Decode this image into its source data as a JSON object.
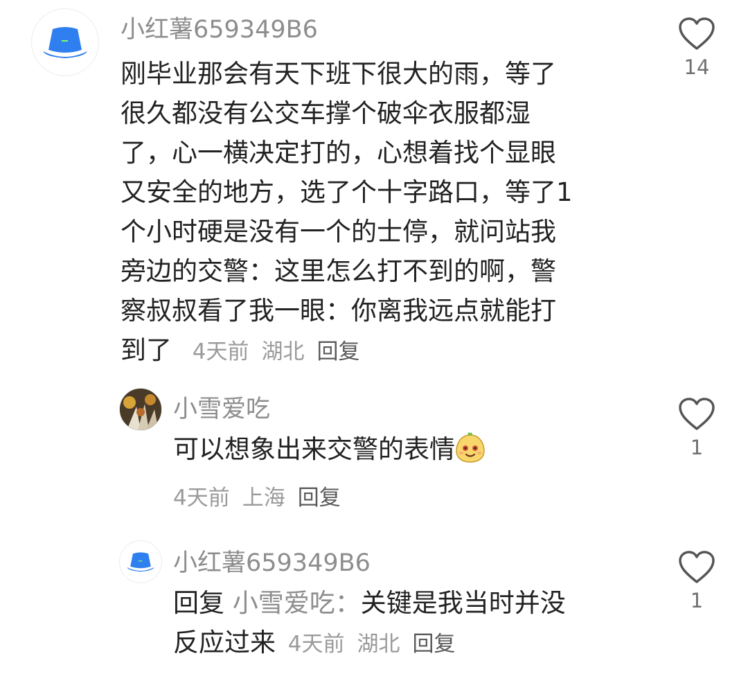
{
  "comments": [
    {
      "username": "小红薯659349B6",
      "avatar_icon": "blue-bucket-hat-icon",
      "text": "刚毕业那会有天下班下很大的雨，等了很久都没有公交车撑个破伞衣服都湿了，心一横决定打的，心想着找个显眼又安全的地方，选了个十字路口，等了1个小时硬是没有一个的士停，就问站我旁边的交警：这里怎么打不到的啊，警察叔叔看了我一眼：你离我远点就能打到了",
      "lines": [
        "刚毕业那会有天下班下很大的雨，等了",
        "很久都没有公交车撑个破伞衣服都湿",
        "了，心一横决定打的，心想着找个显眼",
        "又安全的地方，选了个十字路口，等了1",
        "个小时硬是没有一个的士停，就问站我",
        "旁边的交警：这里怎么打不到的啊，警",
        "察叔叔看了我一眼：你离我远点就能打",
        "到了"
      ],
      "time": "4天前",
      "location": "湖北",
      "reply_label": "回复",
      "likes": "14"
    },
    {
      "username": "小雪爱吃",
      "avatar_icon": "food-photo-avatar",
      "text": "可以想象出来交警的表情",
      "emoji_icon": "smirk-emoji-icon",
      "time": "4天前",
      "location": "上海",
      "reply_label": "回复",
      "likes": "1"
    },
    {
      "username": "小红薯659349B6",
      "avatar_icon": "blue-bucket-hat-icon",
      "reply_prefix": "回复",
      "reply_target": "小雪爱吃：",
      "text_line1": "关键是我当时并没",
      "text_line2": "反应过来",
      "time": "4天前",
      "location": "湖北",
      "reply_label": "回复",
      "likes": "1"
    }
  ],
  "colors": {
    "hat_blue": "#2f7ff0",
    "username_gray": "#8d8d8d",
    "text_dark": "#222222",
    "meta_gray": "#9a9a9a"
  }
}
